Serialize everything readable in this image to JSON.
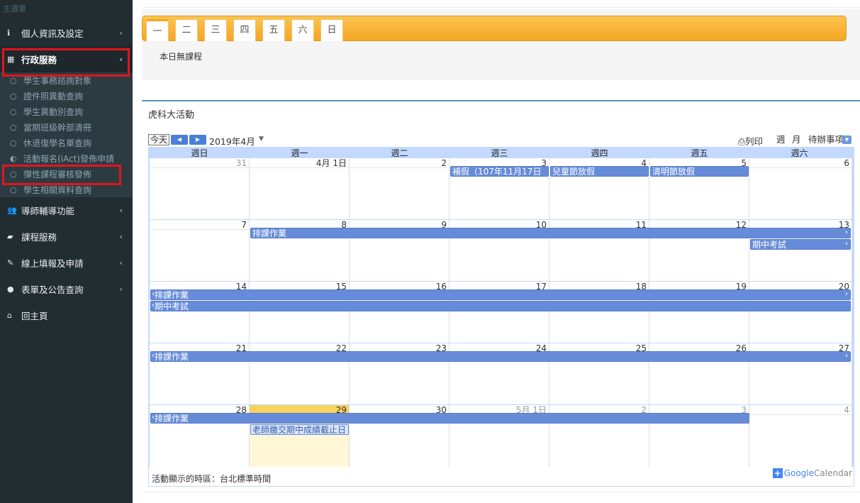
{
  "sidebar": {
    "header": "主選單",
    "items": [
      {
        "icon": "info-icon",
        "label": "個人資訊及設定"
      },
      {
        "icon": "grid-icon",
        "label": "行政服務"
      },
      {
        "icon": "users-icon",
        "label": "導師輔導功能"
      },
      {
        "icon": "book-icon",
        "label": "課程服務"
      },
      {
        "icon": "edit-icon",
        "label": "線上填報及申請"
      },
      {
        "icon": "globe-icon",
        "label": "表單及公告查詢"
      },
      {
        "icon": "home-icon",
        "label": "回主頁"
      }
    ],
    "subitems": [
      "學生事務諮詢對象",
      "證件照異動查詢",
      "學生異動別查詢",
      "當期班級幹部清冊",
      "休退復學名單查詢",
      "活動報名(iAct)發佈申請",
      "彈性課程審核發佈",
      "學生相關資料查詢"
    ]
  },
  "day_tabs": [
    "一",
    "二",
    "三",
    "四",
    "五",
    "六",
    "日"
  ],
  "no_class_text": "本日無課程",
  "section_title": "虎科大活動",
  "calendar": {
    "today_button": "今天",
    "month_label": "2019年4月",
    "print_label": "列印",
    "view_week": "週",
    "view_month": "月",
    "view_agenda": "待辦事項",
    "weekdays": [
      "週日",
      "週一",
      "週二",
      "週三",
      "週四",
      "週五",
      "週六"
    ],
    "weeks": [
      [
        "31",
        "4月 1日",
        "2",
        "3",
        "4",
        "5",
        "6"
      ],
      [
        "7",
        "8",
        "9",
        "10",
        "11",
        "12",
        "13"
      ],
      [
        "14",
        "15",
        "16",
        "17",
        "18",
        "19",
        "20"
      ],
      [
        "21",
        "22",
        "23",
        "24",
        "25",
        "26",
        "27"
      ],
      [
        "28",
        "29",
        "30",
        "5月 1日",
        "2",
        "3",
        "4"
      ]
    ],
    "events": {
      "makeup": "補假（107年11月17日",
      "childrens_day": "兒童節放假",
      "tomb_sweeping": "清明節放假",
      "scheduling": "排課作業",
      "midterm": "期中考試",
      "grade_deadline": "老師繳交期中成績截止日"
    },
    "timezone_text": "活動顯示的時區：台北標準時間",
    "google_label_1": "Google",
    "google_label_2": "Calendar"
  }
}
